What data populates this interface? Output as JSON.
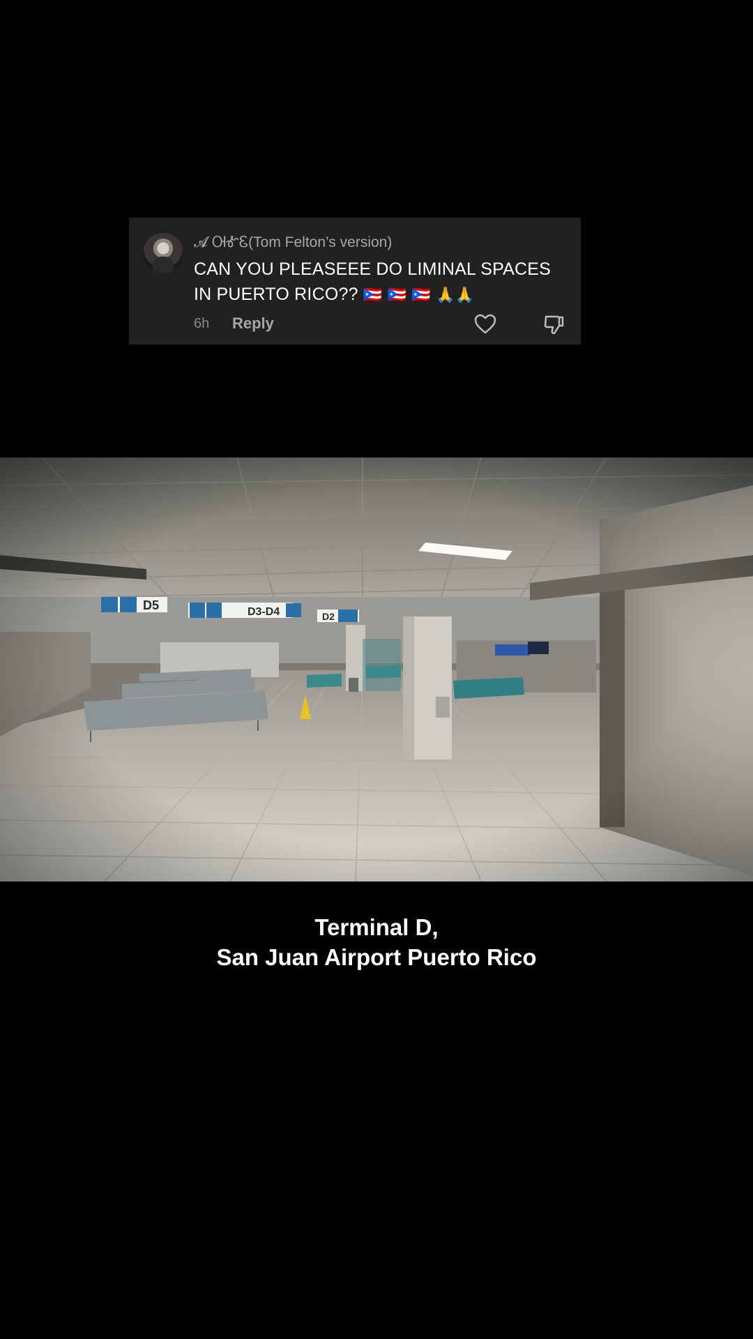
{
  "comment": {
    "username": "𝓐 ᎺᎹᏋ(Tom Felton’s version)",
    "text": "CAN YOU PLEASEEE DO LIMINAL SPACES IN PUERTO RICO??",
    "emoji": "🇵🇷 🇵🇷 🇵🇷 🙏🙏",
    "time": "6h",
    "reply_label": "Reply",
    "icons": {
      "like": "heart-icon",
      "dislike": "thumbs-down-icon",
      "avatar": "avatar"
    }
  },
  "video": {
    "signs": [
      "D5",
      "D3-D4",
      "D2"
    ]
  },
  "caption": {
    "line1": "Terminal D,",
    "line2": "San Juan Airport Puerto Rico"
  }
}
